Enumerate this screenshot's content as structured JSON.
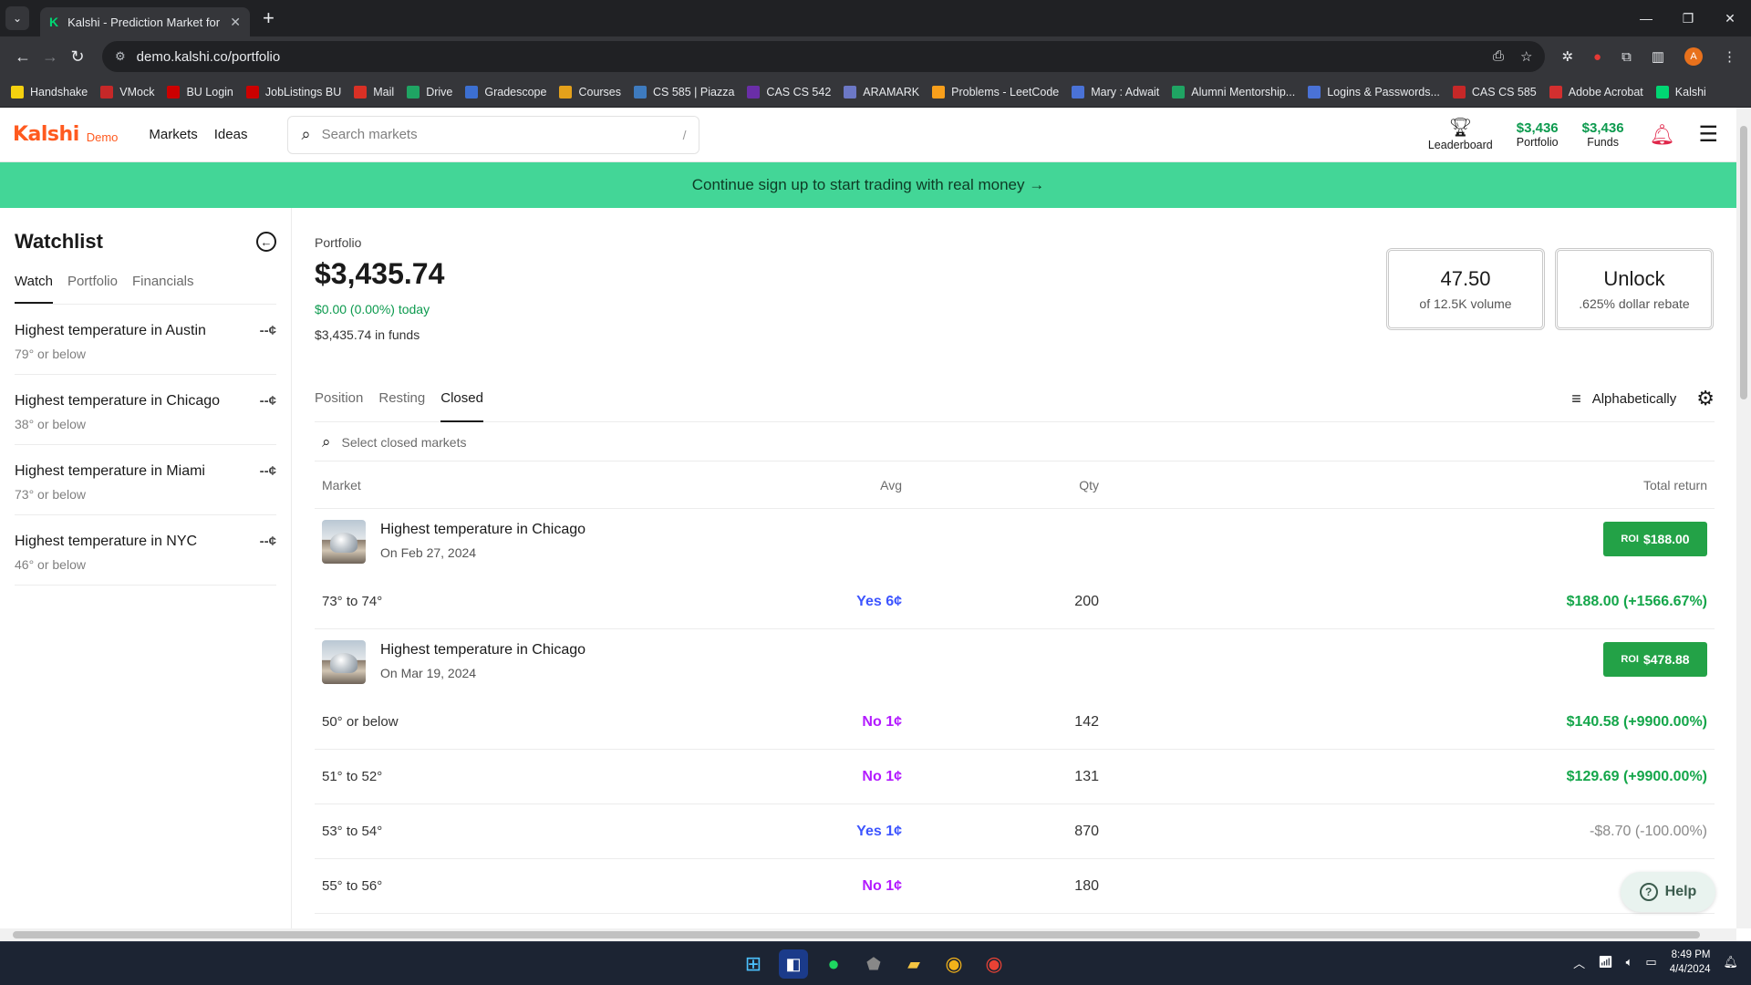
{
  "browser": {
    "tab_title": "Kalshi - Prediction Market for Tr",
    "url": "demo.kalshi.co/portfolio",
    "bookmarks": [
      {
        "label": "Handshake",
        "color": "#f5d10f"
      },
      {
        "label": "VMock",
        "color": "#c62828"
      },
      {
        "label": "BU Login",
        "color": "#cc0000"
      },
      {
        "label": "JobListings BU",
        "color": "#cc0000"
      },
      {
        "label": "Mail",
        "color": "#d93025"
      },
      {
        "label": "Drive",
        "color": "#1fa463"
      },
      {
        "label": "Gradescope",
        "color": "#3c6fd1"
      },
      {
        "label": "Courses",
        "color": "#e4a11b"
      },
      {
        "label": "CS 585 | Piazza",
        "color": "#3e7bbf"
      },
      {
        "label": "CAS CS 542",
        "color": "#6a2ea8"
      },
      {
        "label": "ARAMARK",
        "color": "#6c78c6"
      },
      {
        "label": "Problems - LeetCode",
        "color": "#f89f1b"
      },
      {
        "label": "Mary : Adwait",
        "color": "#4a72d6"
      },
      {
        "label": "Alumni Mentorship...",
        "color": "#1fa463"
      },
      {
        "label": "Logins & Passwords...",
        "color": "#4a72d6"
      },
      {
        "label": "CAS CS 585",
        "color": "#c62828"
      },
      {
        "label": "Adobe Acrobat",
        "color": "#d32f2f"
      },
      {
        "label": "Kalshi",
        "color": "#00d673"
      }
    ]
  },
  "header": {
    "logo": "Kalshi",
    "logo_tag": "Demo",
    "nav": [
      "Markets",
      "Ideas"
    ],
    "search_placeholder": "Search markets",
    "search_shortcut": "/",
    "leaderboard_label": "Leaderboard",
    "portfolio_value": "$3,436",
    "portfolio_label": "Portfolio",
    "funds_value": "$3,436",
    "funds_label": "Funds"
  },
  "banner": {
    "text": "Continue sign up to start trading with real money →"
  },
  "watchlist": {
    "title": "Watchlist",
    "tabs": [
      "Watch",
      "Portfolio",
      "Financials"
    ],
    "items": [
      {
        "name": "Highest temperature in Austin",
        "sub": "79° or below",
        "price": "--¢"
      },
      {
        "name": "Highest temperature in Chicago",
        "sub": "38° or below",
        "price": "--¢"
      },
      {
        "name": "Highest temperature in Miami",
        "sub": "73° or below",
        "price": "--¢"
      },
      {
        "name": "Highest temperature in NYC",
        "sub": "46° or below",
        "price": "--¢"
      }
    ]
  },
  "portfolio": {
    "label": "Portfolio",
    "value": "$3,435.74",
    "change": "$0.00 (0.00%) today",
    "funds": "$3,435.74 in funds",
    "cards": [
      {
        "big": "47.50",
        "small": "of 12.5K volume"
      },
      {
        "big": "Unlock",
        "small": ".625% dollar rebate"
      }
    ],
    "tabs": [
      "Position",
      "Resting",
      "Closed"
    ],
    "sort_label": "Alphabetically",
    "closed_search_placeholder": "Select closed markets",
    "columns": {
      "market": "Market",
      "avg": "Avg",
      "qty": "Qty",
      "ret": "Total return"
    },
    "groups": [
      {
        "title": "Highest temperature in Chicago",
        "date": "On Feb 27, 2024",
        "roi_label": "ROI",
        "roi_value": "$188.00",
        "legs": [
          {
            "name": "73° to 74°",
            "avg": "Yes 6¢",
            "side": "yes",
            "qty": "200",
            "ret": "$188.00 (+1566.67%)",
            "ret_type": "pos"
          }
        ]
      },
      {
        "title": "Highest temperature in Chicago",
        "date": "On Mar 19, 2024",
        "roi_label": "ROI",
        "roi_value": "$478.88",
        "legs": [
          {
            "name": "50° or below",
            "avg": "No 1¢",
            "side": "no",
            "qty": "142",
            "ret": "$140.58 (+9900.00%)",
            "ret_type": "pos"
          },
          {
            "name": "51° to 52°",
            "avg": "No 1¢",
            "side": "no",
            "qty": "131",
            "ret": "$129.69 (+9900.00%)",
            "ret_type": "pos"
          },
          {
            "name": "53° to 54°",
            "avg": "Yes 1¢",
            "side": "yes",
            "qty": "870",
            "ret": "-$8.70 (-100.00%)",
            "ret_type": "neg"
          },
          {
            "name": "55° to 56°",
            "avg": "No 1¢",
            "side": "no",
            "qty": "180",
            "ret": "$178.20 (",
            "ret_type": "pos"
          }
        ]
      }
    ],
    "help_label": "Help"
  },
  "taskbar": {
    "time": "8:49 PM",
    "date": "4/4/2024"
  }
}
